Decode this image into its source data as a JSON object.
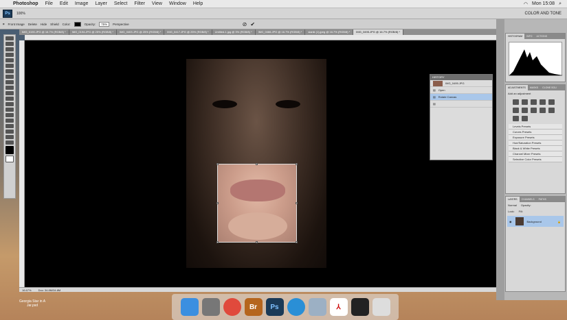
{
  "menubar": {
    "app_name": "Photoshop",
    "items": [
      "File",
      "Edit",
      "Image",
      "Layer",
      "Select",
      "Filter",
      "View",
      "Window",
      "Help"
    ],
    "clock": "Mon 15:08"
  },
  "toolbar_top": {
    "ps_label": "Ps",
    "zoom_value": "100%",
    "workspace": "COLOR AND TONE"
  },
  "options": {
    "front_image": "Front Image",
    "delete_label": "Delete",
    "hide_label": "Hide",
    "shield_label": "Shield",
    "color_label": "Color:",
    "opacity_label": "Opacity:",
    "opacity_value": "75%",
    "perspective_label": "Perspective"
  },
  "doc_tabs": [
    "IMG_0190.JPG @ 16.7% (RGB/8) *",
    "IMG_0194.JPG @ 25% (RGB/8) *",
    "IMG_0403.JPG @ 25% (RGB/8) *",
    "IMG_0417.JPG @ 25% (RGB/8) *",
    "Untitled-1.jpg @ 3% (RGB/8) *",
    "IMG_0466.JPG @ 16.7% (RGB/8) *",
    "sianik (1).jpeg @ 16.7% (RGB/8) *",
    "IMG_0495.JPG @ 16.7% (RGB/8) *"
  ],
  "active_tab_index": 7,
  "status": {
    "zoom": "16.67%",
    "doc": "Doc: 34.8M/34.8M"
  },
  "history": {
    "title": "HISTORY",
    "snapshot": "IMG_0495.JPG",
    "steps": [
      "Open",
      "Rotate Canvas"
    ],
    "active_step": 1
  },
  "right_panels": {
    "histogram_tabs": [
      "HISTOGRAM",
      "INFO",
      "ACTIONS"
    ],
    "adjust_tabs": [
      "ADJUSTMENTS",
      "MASKS",
      "CLONE SOU"
    ],
    "adjust_title": "Add an adjustment",
    "presets": [
      "Levels Presets",
      "Curves Presets",
      "Exposure Presets",
      "Hue/Saturation Presets",
      "Black & White Presets",
      "Channel Mixer Presets",
      "Selective Color Presets"
    ],
    "layers_tabs": [
      "LAYERS",
      "CHANNELS",
      "PATHS"
    ],
    "blend_mode": "Normal",
    "opacity_label": "Opacity:",
    "fill_label": "Fill:",
    "lock_label": "Lock:",
    "layer_name": "Background"
  },
  "dock": {
    "items": [
      "Finder",
      "System Preferences",
      "Chrome",
      "Br",
      "Ps",
      "Safari",
      "Preview",
      "Acrobat",
      "Terminal",
      "Trash"
    ]
  },
  "desktop": {
    "file_label": "Georgia Star in A Jar.psd"
  },
  "colors": {
    "accent_blue": "#a9c7ea",
    "panel_gray": "#d8d8d8"
  }
}
